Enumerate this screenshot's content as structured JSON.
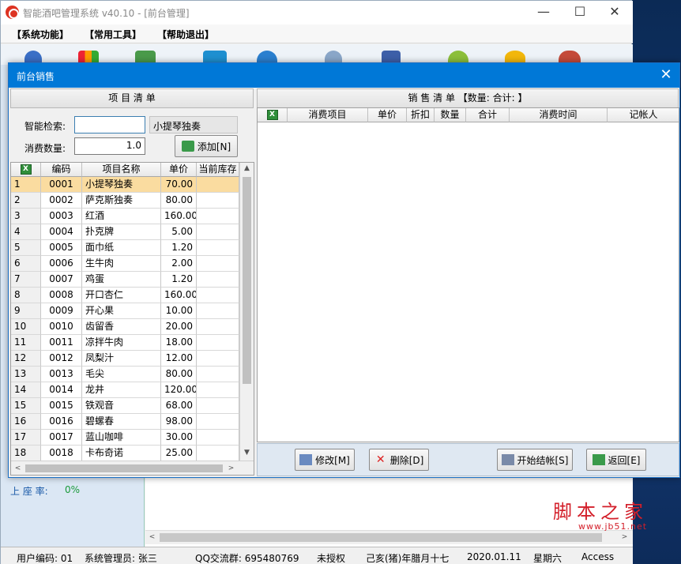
{
  "main_window": {
    "title": "智能酒吧管理系统 v40.10 - [前台管理]",
    "minimize": "—",
    "maximize": "☐",
    "close": "✕"
  },
  "menu": [
    "【系统功能】",
    "【常用工具】",
    "【帮助退出】"
  ],
  "side": {
    "seat_rate_label": "上 座 率:",
    "seat_rate_value": "0%"
  },
  "dialog": {
    "title": "前台销售",
    "close": "✕",
    "left_header": "项 目 清 单",
    "right_header": "销 售 清 单 【数量:    合计: 】",
    "search_label": "智能检索:",
    "search_value": "",
    "search_result": "小提琴独奏",
    "qty_label": "消费数量:",
    "qty_value": "1.0",
    "add_button": "添加[N]",
    "items_columns": [
      "编码",
      "项目名称",
      "单价",
      "当前库存"
    ],
    "items": [
      {
        "rn": "1",
        "code": "0001",
        "name": "小提琴独奏",
        "price": "70.00",
        "stock": ""
      },
      {
        "rn": "2",
        "code": "0002",
        "name": "萨克斯独奏",
        "price": "80.00",
        "stock": ""
      },
      {
        "rn": "3",
        "code": "0003",
        "name": "红酒",
        "price": "160.00",
        "stock": ""
      },
      {
        "rn": "4",
        "code": "0004",
        "name": "扑克牌",
        "price": "5.00",
        "stock": ""
      },
      {
        "rn": "5",
        "code": "0005",
        "name": "面巾纸",
        "price": "1.20",
        "stock": ""
      },
      {
        "rn": "6",
        "code": "0006",
        "name": "生牛肉",
        "price": "2.00",
        "stock": ""
      },
      {
        "rn": "7",
        "code": "0007",
        "name": "鸡蛋",
        "price": "1.20",
        "stock": ""
      },
      {
        "rn": "8",
        "code": "0008",
        "name": "开口杏仁",
        "price": "160.00",
        "stock": ""
      },
      {
        "rn": "9",
        "code": "0009",
        "name": "开心果",
        "price": "10.00",
        "stock": ""
      },
      {
        "rn": "10",
        "code": "0010",
        "name": "齿留香",
        "price": "20.00",
        "stock": ""
      },
      {
        "rn": "11",
        "code": "0011",
        "name": "凉拌牛肉",
        "price": "18.00",
        "stock": ""
      },
      {
        "rn": "12",
        "code": "0012",
        "name": "凤梨汁",
        "price": "12.00",
        "stock": ""
      },
      {
        "rn": "13",
        "code": "0013",
        "name": "毛尖",
        "price": "80.00",
        "stock": ""
      },
      {
        "rn": "14",
        "code": "0014",
        "name": "龙井",
        "price": "120.00",
        "stock": ""
      },
      {
        "rn": "15",
        "code": "0015",
        "name": "铁观音",
        "price": "68.00",
        "stock": ""
      },
      {
        "rn": "16",
        "code": "0016",
        "name": "碧螺春",
        "price": "98.00",
        "stock": ""
      },
      {
        "rn": "17",
        "code": "0017",
        "name": "蓝山咖啡",
        "price": "30.00",
        "stock": ""
      },
      {
        "rn": "18",
        "code": "0018",
        "name": "卡布奇诺",
        "price": "25.00",
        "stock": ""
      }
    ],
    "sales_columns": [
      "消费项目",
      "单价",
      "折扣",
      "数量",
      "合计",
      "消费时间",
      "记帐人"
    ],
    "buttons": {
      "modify": "修改[M]",
      "delete": "删除[D]",
      "checkout": "开始结帐[S]",
      "back": "返回[E]"
    }
  },
  "statusbar": {
    "user_code": "用户编码: 01",
    "admin": "系统管理员: 张三",
    "qq": "QQ交流群: 695480769",
    "license": "未授权",
    "lunar": "己亥(猪)年腊月十七",
    "date": "2020.01.11",
    "weekday": "星期六",
    "db": "Access"
  },
  "watermark": {
    "text": "脚本之家",
    "url": "www.jb51.net"
  },
  "colors": {
    "title_blue": "#0078d7",
    "selected_row": "#fadca0",
    "excel_green": "#2f8f3a"
  }
}
